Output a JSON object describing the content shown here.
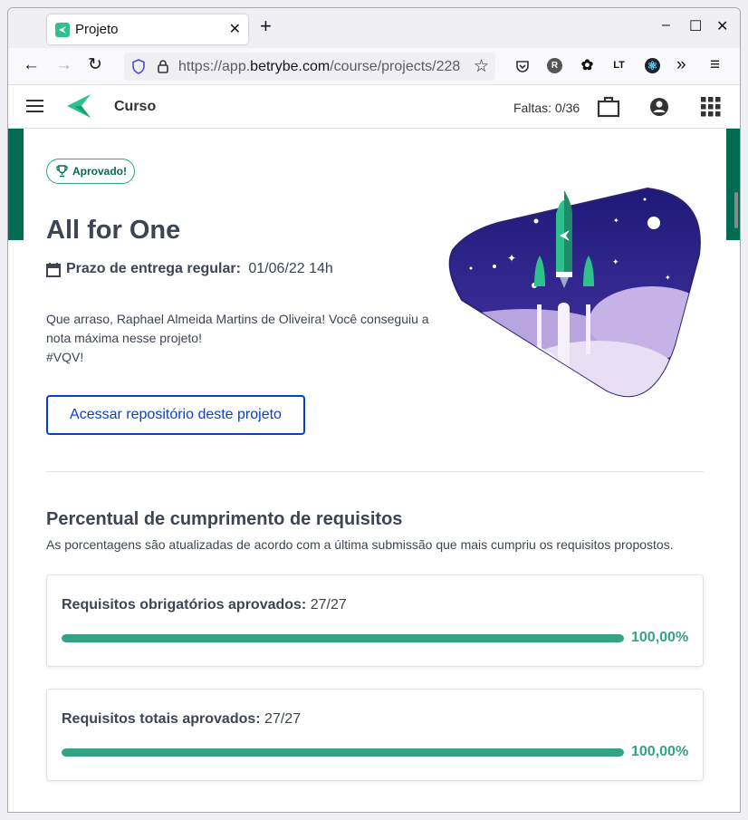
{
  "browser": {
    "tab_title": "Projeto",
    "url_prefix": "https://app.",
    "url_domain": "betrybe.com",
    "url_path": "/course/projects/228"
  },
  "app": {
    "title": "Curso",
    "faltas": "Faltas: 0/36"
  },
  "project": {
    "badge": "Aprovado!",
    "title": "All for One",
    "deadline_label": "Prazo de entrega regular:",
    "deadline_value": "01/06/22 14h",
    "message_line1": "Que arraso, Raphael Almeida Martins de Oliveira! Você conseguiu a nota máxima nesse projeto!",
    "message_line2": "#VQV!",
    "repo_button": "Acessar repositório deste projeto"
  },
  "requirements": {
    "title": "Percentual de cumprimento de requisitos",
    "subtitle": "As porcentagens são atualizadas de acordo com a última submissão que mais cumpriu os requisitos propostos.",
    "items": [
      {
        "label": "Requisitos obrigatórios aprovados:",
        "value": "27/27",
        "percent_text": "100,00%",
        "progress": 1.0
      },
      {
        "label": "Requisitos totais aprovados:",
        "value": "27/27",
        "percent_text": "100,00%",
        "progress": 1.0
      }
    ]
  },
  "colors": {
    "brand_green": "#036b52",
    "progress_green": "#35a286",
    "link_blue": "#0a3fc9"
  }
}
